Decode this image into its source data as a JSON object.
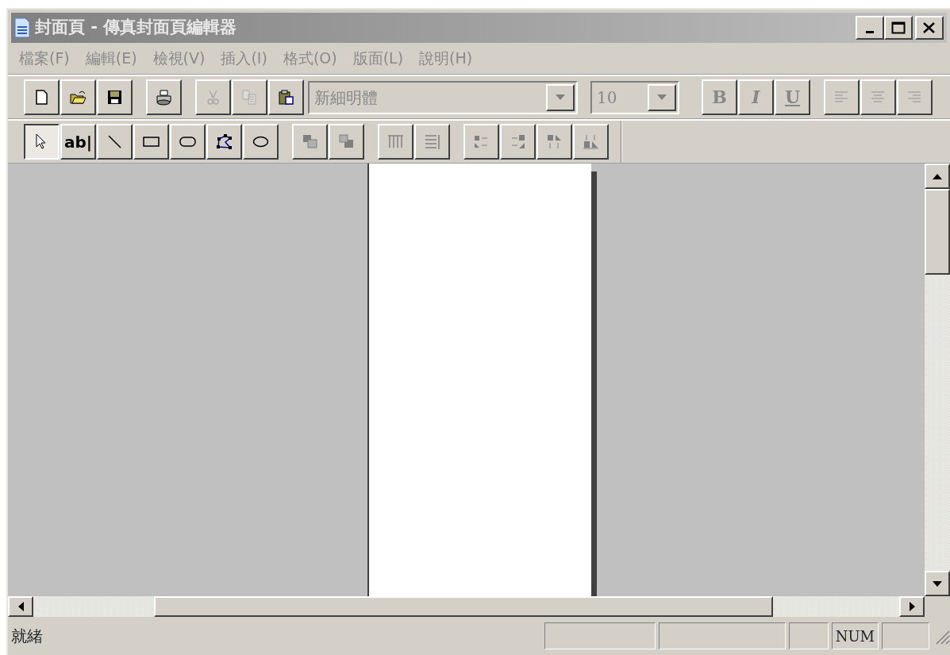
{
  "window": {
    "title": "封面頁 - 傳真封面頁編輯器",
    "active": false
  },
  "menu": [
    {
      "label": "檔案(F)",
      "disabled": true
    },
    {
      "label": "編輯(E)",
      "disabled": true
    },
    {
      "label": "檢視(V)",
      "disabled": true
    },
    {
      "label": "插入(I)",
      "disabled": true
    },
    {
      "label": "格式(O)",
      "disabled": true
    },
    {
      "label": "版面(L)",
      "disabled": true
    },
    {
      "label": "說明(H)",
      "disabled": true
    }
  ],
  "toolbar": [
    {
      "kind": "button",
      "disabled": false
    },
    {
      "kind": "button",
      "disabled": false
    },
    {
      "kind": "button",
      "disabled": false
    },
    {
      "kind": "separator"
    },
    {
      "kind": "button",
      "disabled": false
    },
    {
      "kind": "separator"
    },
    {
      "kind": "button",
      "disabled": true
    },
    {
      "kind": "button",
      "disabled": true
    },
    {
      "kind": "button",
      "disabled": false
    },
    {
      "kind": "combo",
      "value": "新細明體",
      "disabled": true
    },
    {
      "kind": "combo",
      "value": "10",
      "disabled": true
    },
    {
      "kind": "separator"
    },
    {
      "kind": "button",
      "label": "B",
      "disabled": true
    },
    {
      "kind": "button",
      "label": "I",
      "disabled": true
    },
    {
      "kind": "button",
      "label": "U",
      "disabled": true
    },
    {
      "kind": "separator"
    },
    {
      "kind": "button",
      "disabled": true
    },
    {
      "kind": "button",
      "disabled": true
    },
    {
      "kind": "button",
      "disabled": true
    }
  ],
  "drawing_toolbar": [
    {
      "kind": "button",
      "selected": true
    },
    {
      "kind": "button",
      "label": "ab|",
      "selected": false
    },
    {
      "kind": "button",
      "selected": false
    },
    {
      "kind": "button",
      "selected": false
    },
    {
      "kind": "button",
      "selected": false
    },
    {
      "kind": "button",
      "selected": false
    },
    {
      "kind": "button",
      "selected": false
    },
    {
      "kind": "separator"
    },
    {
      "kind": "button",
      "selected": false
    },
    {
      "kind": "button",
      "selected": false
    },
    {
      "kind": "separator"
    },
    {
      "kind": "button",
      "selected": false
    },
    {
      "kind": "button",
      "selected": false
    },
    {
      "kind": "separator"
    },
    {
      "kind": "button",
      "selected": false
    },
    {
      "kind": "button",
      "selected": false
    },
    {
      "kind": "button",
      "selected": false
    },
    {
      "kind": "button",
      "selected": false
    }
  ],
  "status_bar": {
    "message": "就緒",
    "indicators": [
      "NUM"
    ]
  }
}
